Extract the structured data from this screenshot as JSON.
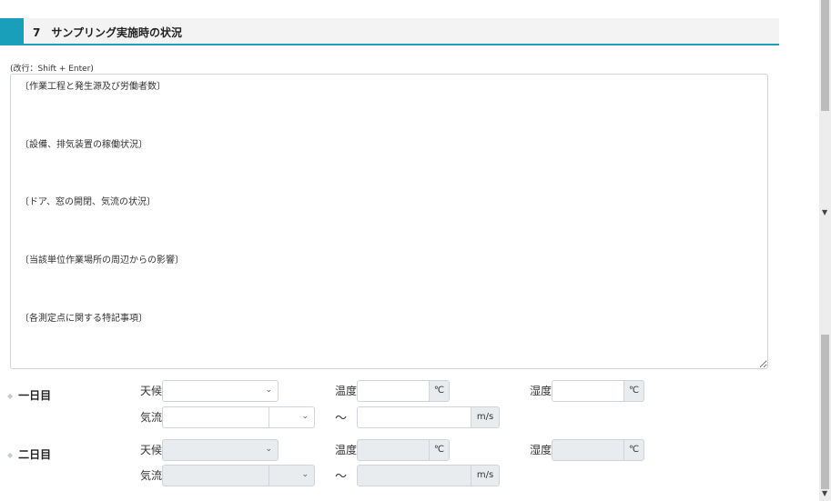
{
  "section": {
    "number_title": "7　サンプリング実施時の状況"
  },
  "memo": {
    "hint": "(改行：Shift + Enter)",
    "value": "〔作業工程と発生源及び労働者数〕\n\n\n\n〔設備、排気装置の稼働状況〕\n\n\n\n〔ドア、窓の開閉、気流の状況〕\n\n\n\n〔当該単位作業場所の周辺からの影響〕\n\n\n\n〔各測定点に関する特記事項〕"
  },
  "days": [
    {
      "label": "一日目",
      "weather_label": "天候",
      "temperature_label": "温度",
      "humidity_label": "湿度",
      "airflow_label": "気流",
      "temp_unit": "℃",
      "humidity_unit": "℃",
      "airflow_unit": "m/s",
      "tilde": "〜"
    },
    {
      "label": "二日目",
      "weather_label": "天候",
      "temperature_label": "温度",
      "humidity_label": "湿度",
      "airflow_label": "気流",
      "temp_unit": "℃",
      "humidity_unit": "℃",
      "airflow_unit": "m/s",
      "tilde": "〜"
    }
  ]
}
